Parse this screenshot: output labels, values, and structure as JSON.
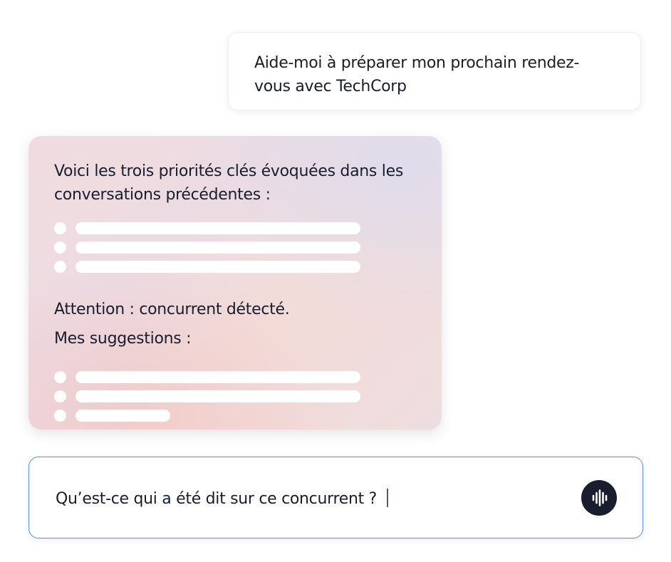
{
  "user_message": {
    "text": "Aide-moi à préparer mon prochain rendez-vous avec TechCorp"
  },
  "assistant_card": {
    "intro": "Voici les trois priorités clés évoquées dans les conversations précédentes :",
    "warning": "Attention : concurrent détecté.",
    "suggestions_title": "Mes suggestions :"
  },
  "input": {
    "value": "Qu’est-ce qui a été dit sur ce concurrent ?",
    "voice_icon": "voice-waveform-icon"
  },
  "colors": {
    "text": "#1a1d2e",
    "input_border": "#5b8fe8",
    "voice_button": "#1a1d2e",
    "placeholder_bars": "#ffffff"
  }
}
